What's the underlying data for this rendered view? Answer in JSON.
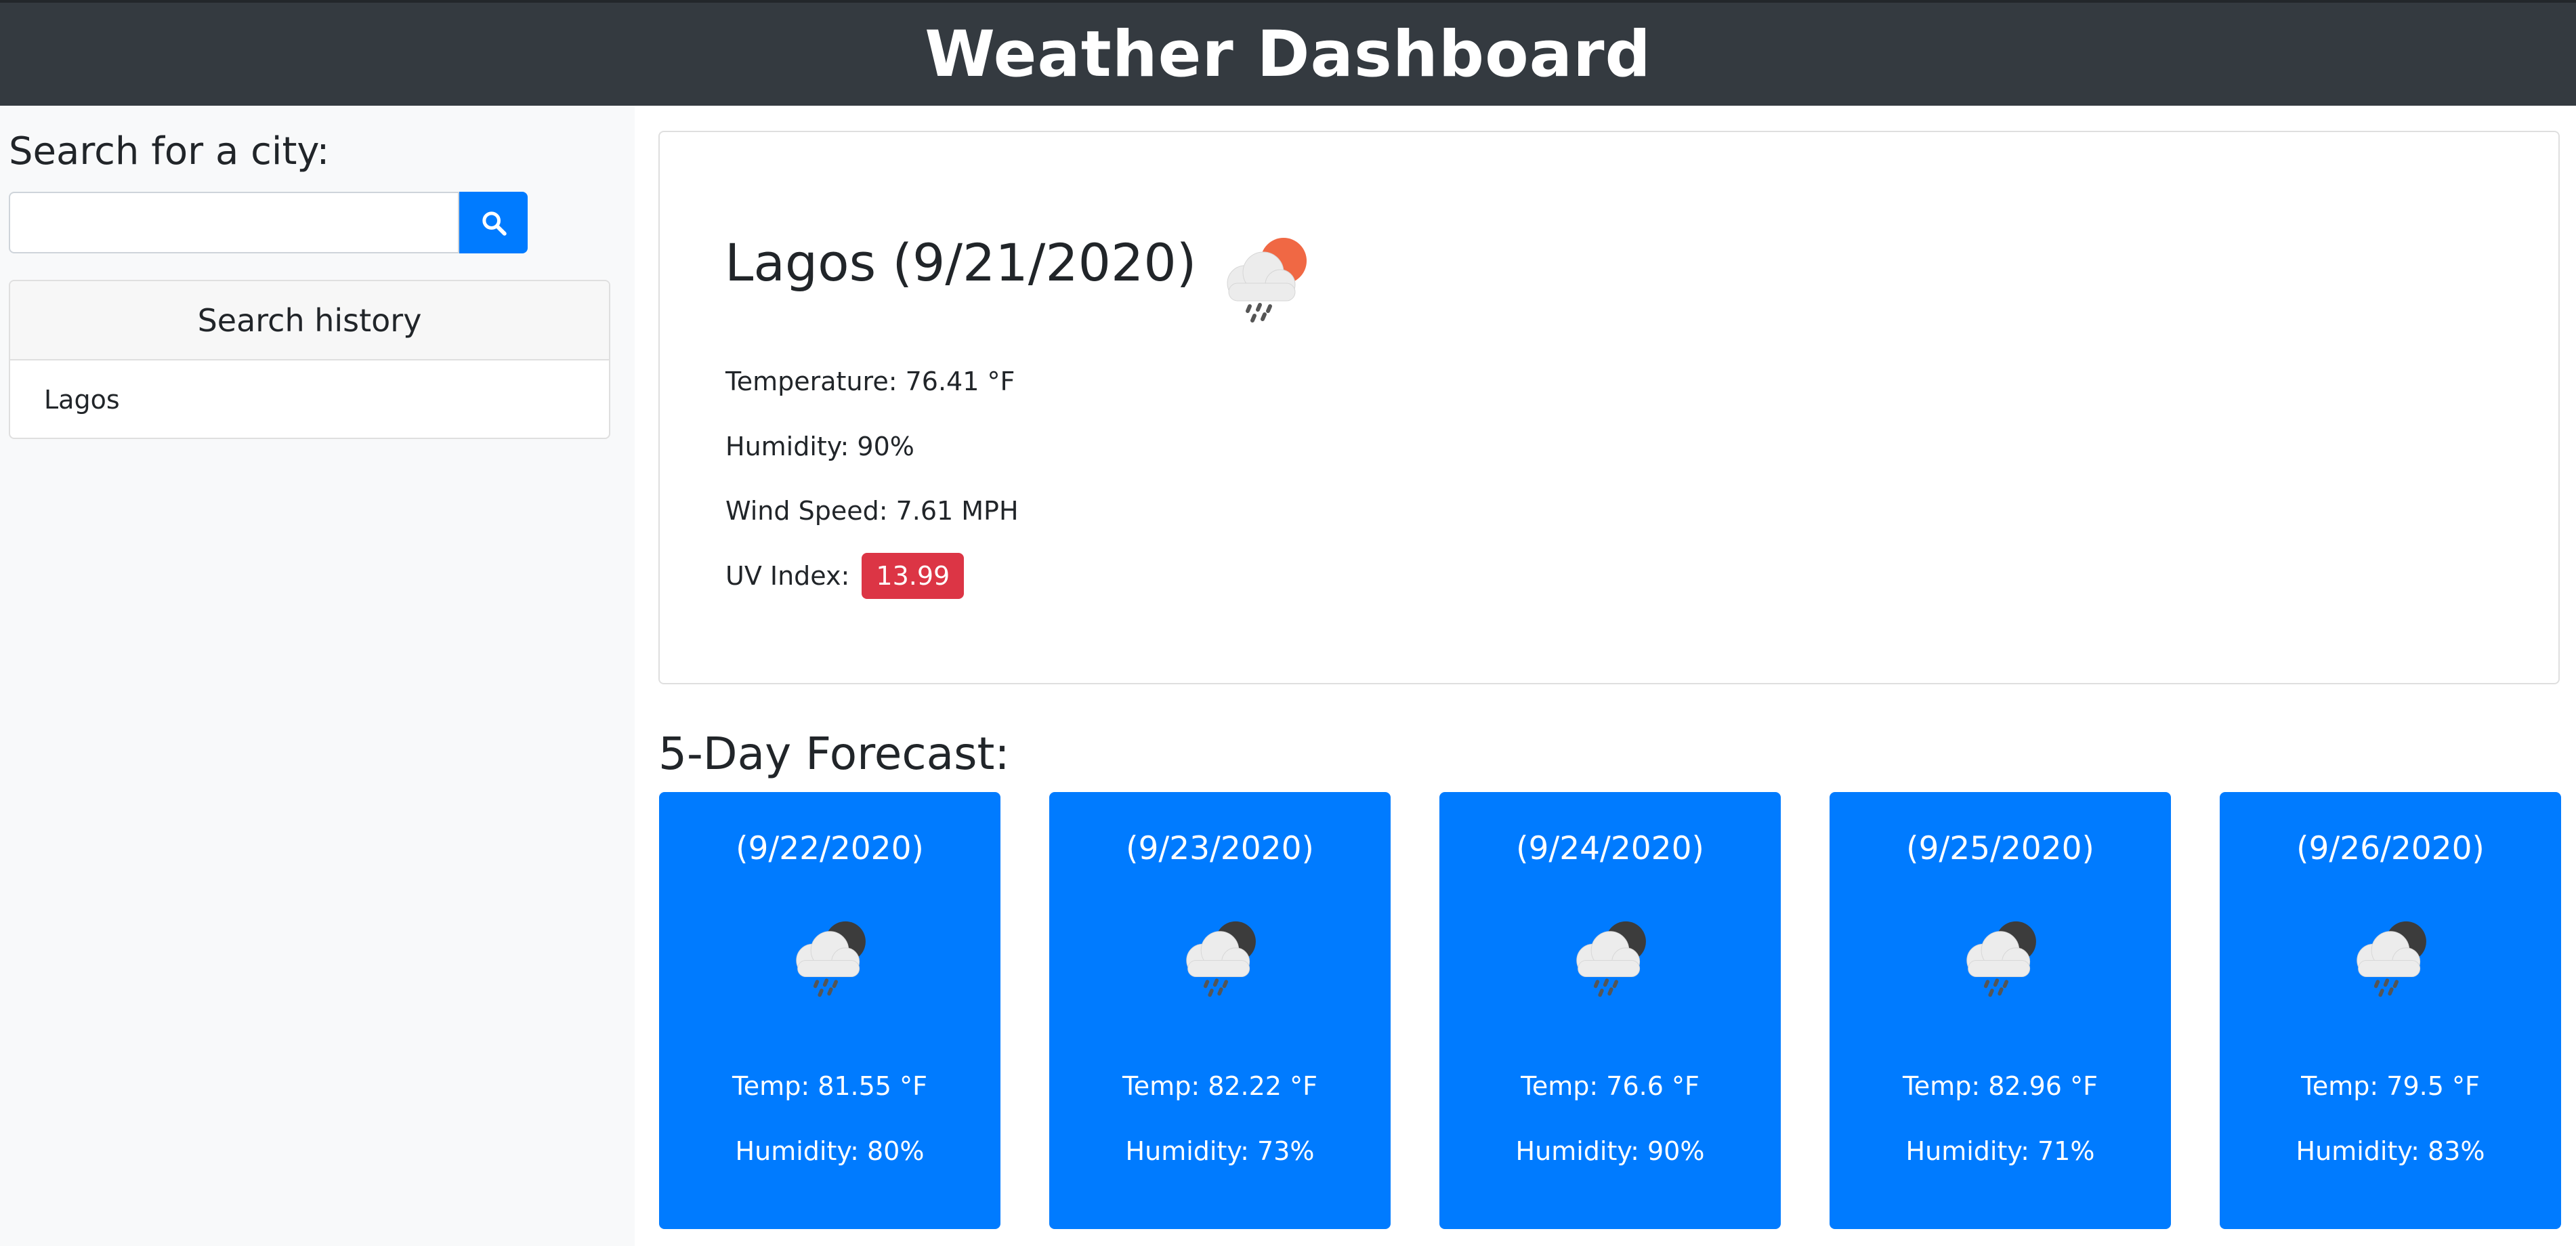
{
  "header": {
    "title": "Weather Dashboard"
  },
  "sidebar": {
    "search_label": "Search for a city:",
    "search_value": "",
    "search_button_icon": "search-icon",
    "history_title": "Search history",
    "history_items": [
      "Lagos"
    ]
  },
  "current": {
    "title": "Lagos (9/21/2020)",
    "icon": "rain-cloud-sun-icon",
    "temperature": "Temperature: 76.41 °F",
    "humidity": "Humidity: 90%",
    "wind": "Wind Speed: 7.61 MPH",
    "uv_label": "UV Index:",
    "uv_value": "13.99",
    "uv_color": "#dc3545"
  },
  "forecast": {
    "title": "5-Day Forecast:",
    "card_color": "#007bff",
    "days": [
      {
        "date": "(9/22/2020)",
        "icon": "rain-cloud-moon-icon",
        "temp": "Temp: 81.55 °F",
        "humidity": "Humidity: 80%"
      },
      {
        "date": "(9/23/2020)",
        "icon": "rain-cloud-moon-icon",
        "temp": "Temp: 82.22 °F",
        "humidity": "Humidity: 73%"
      },
      {
        "date": "(9/24/2020)",
        "icon": "rain-cloud-moon-icon",
        "temp": "Temp: 76.6 °F",
        "humidity": "Humidity: 90%"
      },
      {
        "date": "(9/25/2020)",
        "icon": "rain-cloud-moon-icon",
        "temp": "Temp: 82.96 °F",
        "humidity": "Humidity: 71%"
      },
      {
        "date": "(9/26/2020)",
        "icon": "rain-cloud-moon-icon",
        "temp": "Temp: 79.5 °F",
        "humidity": "Humidity: 83%"
      }
    ]
  }
}
